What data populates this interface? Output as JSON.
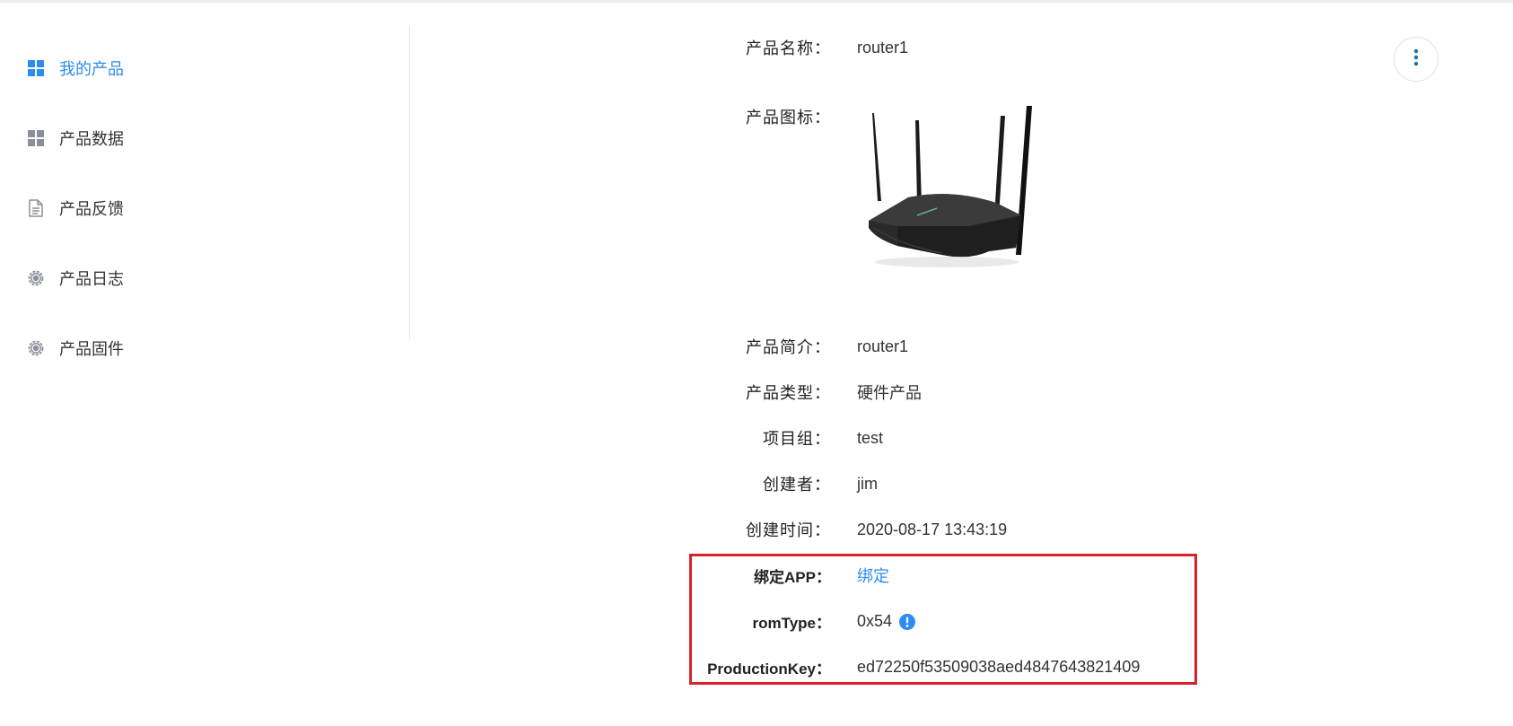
{
  "sidebar": {
    "items": [
      {
        "label": "我的产品",
        "icon": "grid-icon",
        "active": true
      },
      {
        "label": "产品数据",
        "icon": "grid-icon",
        "active": false
      },
      {
        "label": "产品反馈",
        "icon": "document-icon",
        "active": false
      },
      {
        "label": "产品日志",
        "icon": "gear-icon",
        "active": false
      },
      {
        "label": "产品固件",
        "icon": "gear-icon",
        "active": false
      }
    ]
  },
  "detail": {
    "name_label": "产品名称：",
    "name_value": "router1",
    "icon_label": "产品图标：",
    "desc_label": "产品简介：",
    "desc_value": "router1",
    "type_label": "产品类型：",
    "type_value": "硬件产品",
    "group_label": "项目组：",
    "group_value": "test",
    "creator_label": "创建者：",
    "creator_value": "jim",
    "created_label": "创建时间：",
    "created_value": "2020-08-17 13:43:19",
    "bind_label": "绑定APP：",
    "bind_link": "绑定",
    "romtype_label": "romType：",
    "romtype_value": "0x54",
    "prodkey_label": "ProductionKey：",
    "prodkey_value": "ed72250f53509038aed4847643821409"
  },
  "colors": {
    "accent": "#2d8cf0",
    "highlight_box": "#d9222b",
    "icon_gray": "#8a8f99"
  }
}
